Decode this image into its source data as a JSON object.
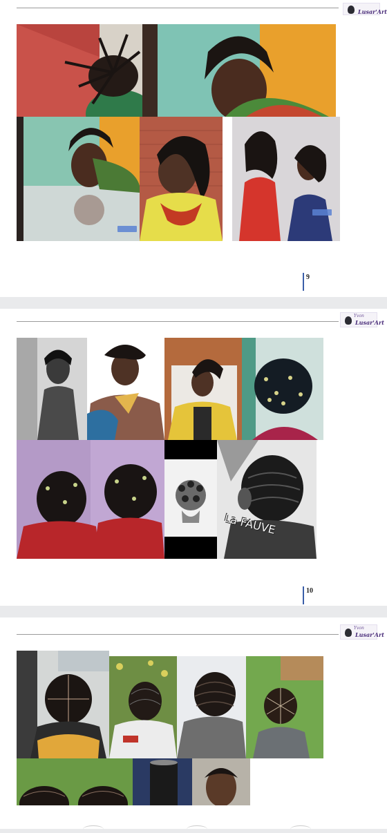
{
  "document": {
    "pages": [
      {
        "page_number": "9",
        "watermark": "Lusar'Art"
      },
      {
        "page_number": "10",
        "watermark": "Lusar'Art"
      },
      {
        "page_number": "",
        "watermark": "Lusar'Art"
      }
    ],
    "logo": {
      "line1": "Yvon",
      "line2": "Lusar'Art"
    },
    "photo_caption": "La FAUVE",
    "colors": {
      "page_bg": "#ffffff",
      "gap_bg": "#e9eaec",
      "rule": "#9a9a9a",
      "page_number_bar": "#3a5ea8"
    }
  }
}
